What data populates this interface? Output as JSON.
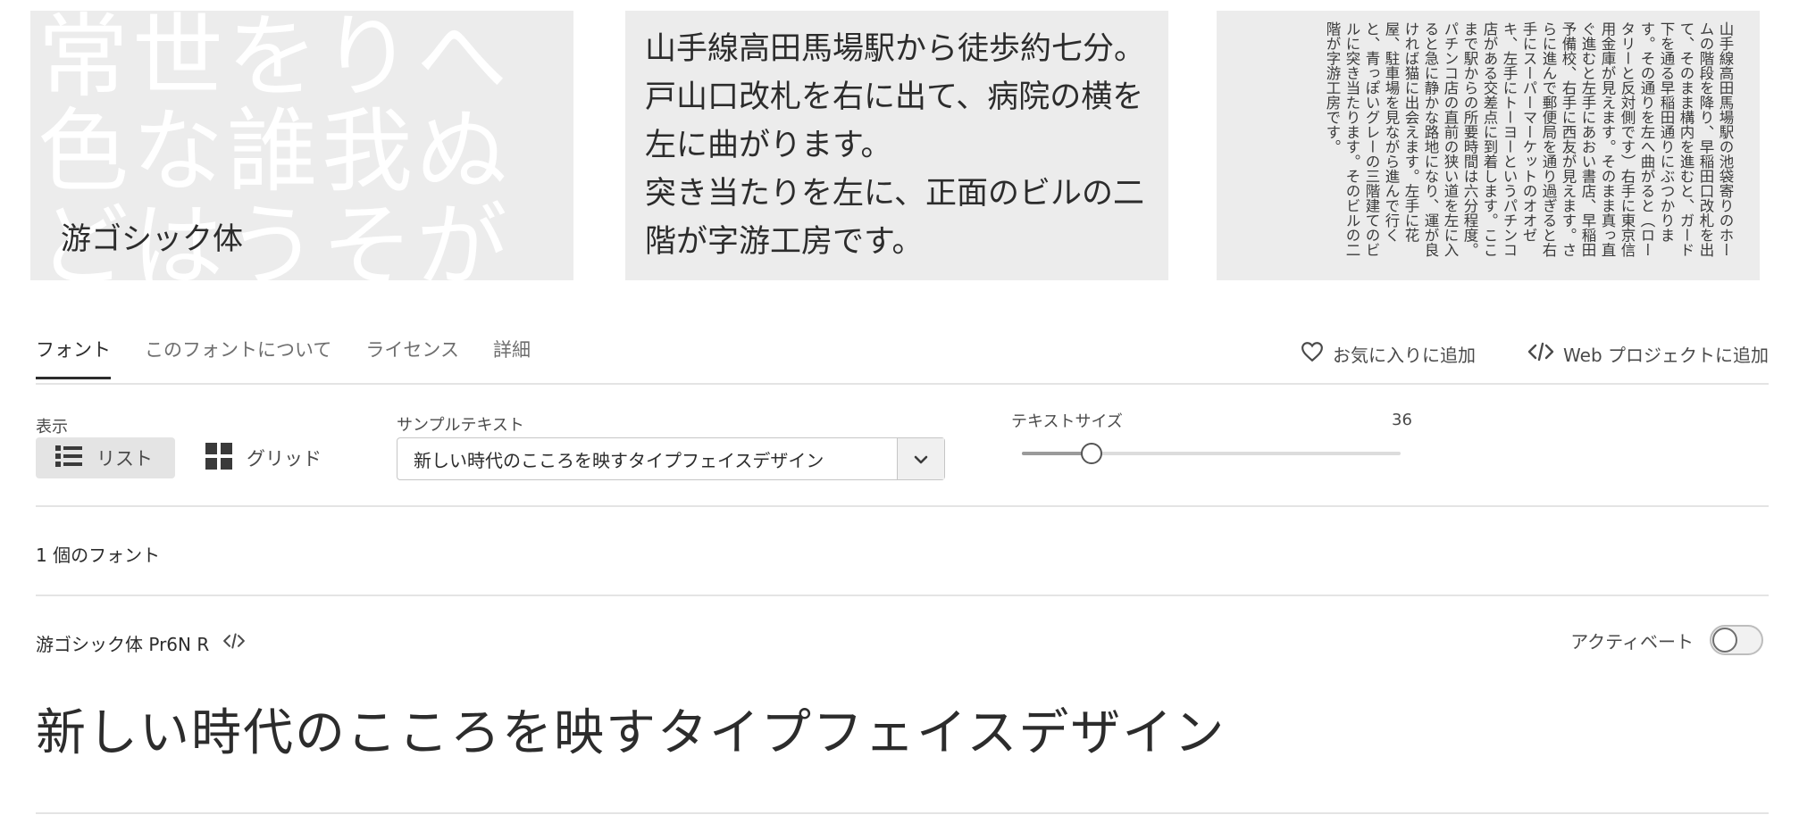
{
  "panels": {
    "display": {
      "bg_glyphs": "常世をりへ色な誰我ぬどはうそがる散句",
      "caption": "游ゴシック体"
    },
    "horizontal_sample": {
      "lines": [
        "山手線高田馬場駅から徒歩約七分。戸山口改札を右に出て、病院の横を左に曲がります。",
        "突き当たりを左に、正面のビルの二階が字游工房です。"
      ]
    },
    "vertical_sample": {
      "text": "山手線高田馬場駅の池袋寄りのホームの階段を降り、早稲田口改札を出て、そのまま構内を進むと、ガード下を通る早稲田通りにぶつかります。その通りを左へ曲がると（ロータリーと反対側です）右手に東京信用金庫が見えます。そのまま真っ直ぐ進むと左手にあおい書店、早稲田予備校、右手に西友が見えます。さらに進んで郵便局を通り過ぎると右手にスーパーマーケットのオオゼキ、左手にトーヨーというパチンコ店がある交差点に到着します。ここまで駅からの所要時間は六分程度。パチンコ店の直前の狭い道を左に入ると急に静かな路地になり、運が良ければ猫に出会えます。左手に花屋、駐車場を見ながら進んで行くと、青っぽいグレーの三階建てのビルに突き当たります。そのビルの二階が字游工房です。"
    }
  },
  "tabs": [
    {
      "label": "フォント",
      "active": true
    },
    {
      "label": "このフォントについて",
      "active": false
    },
    {
      "label": "ライセンス",
      "active": false
    },
    {
      "label": "詳細",
      "active": false
    }
  ],
  "actions": {
    "favorite": {
      "label": "お気に入りに追加",
      "icon": "heart-icon"
    },
    "web_project": {
      "label": "Web プロジェクトに追加",
      "icon": "code-icon"
    }
  },
  "controls": {
    "view": {
      "label": "表示",
      "list_label": "リスト",
      "grid_label": "グリッド",
      "selected": "list"
    },
    "sample_text": {
      "label": "サンプルテキスト",
      "value": "新しい時代のこころを映すタイプフェイスデザイン"
    },
    "text_size": {
      "label": "テキストサイズ",
      "value": "36",
      "min": 8,
      "max": 160,
      "current": 36
    }
  },
  "font_count": "1 個のフォント",
  "font_entry": {
    "name": "游ゴシック体 Pr6N R",
    "activate_label": "アクティベート",
    "active": false,
    "preview": "新しい時代のこころを映すタイプフェイスデザイン"
  },
  "colors": {
    "text": "#2c2c2c",
    "panel_bg": "#ececec",
    "divider": "#e4e4e4"
  }
}
